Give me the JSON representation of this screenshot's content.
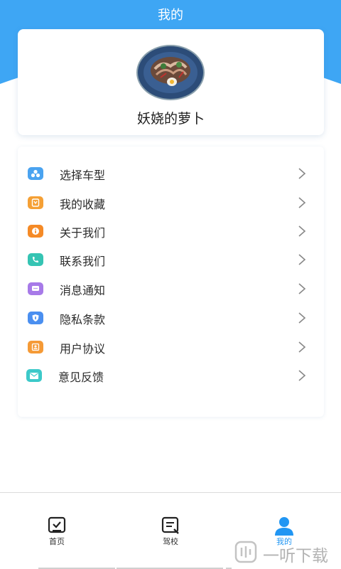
{
  "header": {
    "title": "我的",
    "accent": "#3ea6f4"
  },
  "profile": {
    "username": "妖娆的萝卜",
    "avatar_icon": "food-bowl-avatar"
  },
  "menu": {
    "items": [
      {
        "label": "选择车型",
        "icon": "car-type-icon",
        "color": "#4aa3f0"
      },
      {
        "label": "我的收藏",
        "icon": "bookmark-icon",
        "color": "#f5a035"
      },
      {
        "label": "关于我们",
        "icon": "info-icon",
        "color": "#f58a26"
      },
      {
        "label": "联系我们",
        "icon": "phone-icon",
        "color": "#35c4b3"
      },
      {
        "label": "消息通知",
        "icon": "message-icon",
        "color": "#a77ae8"
      },
      {
        "label": "隐私条款",
        "icon": "shield-icon",
        "color": "#4a8ff0"
      },
      {
        "label": "用户协议",
        "icon": "user-card-icon",
        "color": "#f59a36"
      },
      {
        "label": "意见反馈",
        "icon": "mail-icon",
        "color": "#3cc9c9"
      }
    ]
  },
  "nav": {
    "items": [
      {
        "label": "首页",
        "icon": "home-checklist-icon",
        "active": false
      },
      {
        "label": "驾校",
        "icon": "school-doc-icon",
        "active": false
      },
      {
        "label": "我的",
        "icon": "person-icon",
        "active": true
      }
    ],
    "active_color": "#2196f3"
  },
  "watermark": {
    "text": "一听下载"
  }
}
